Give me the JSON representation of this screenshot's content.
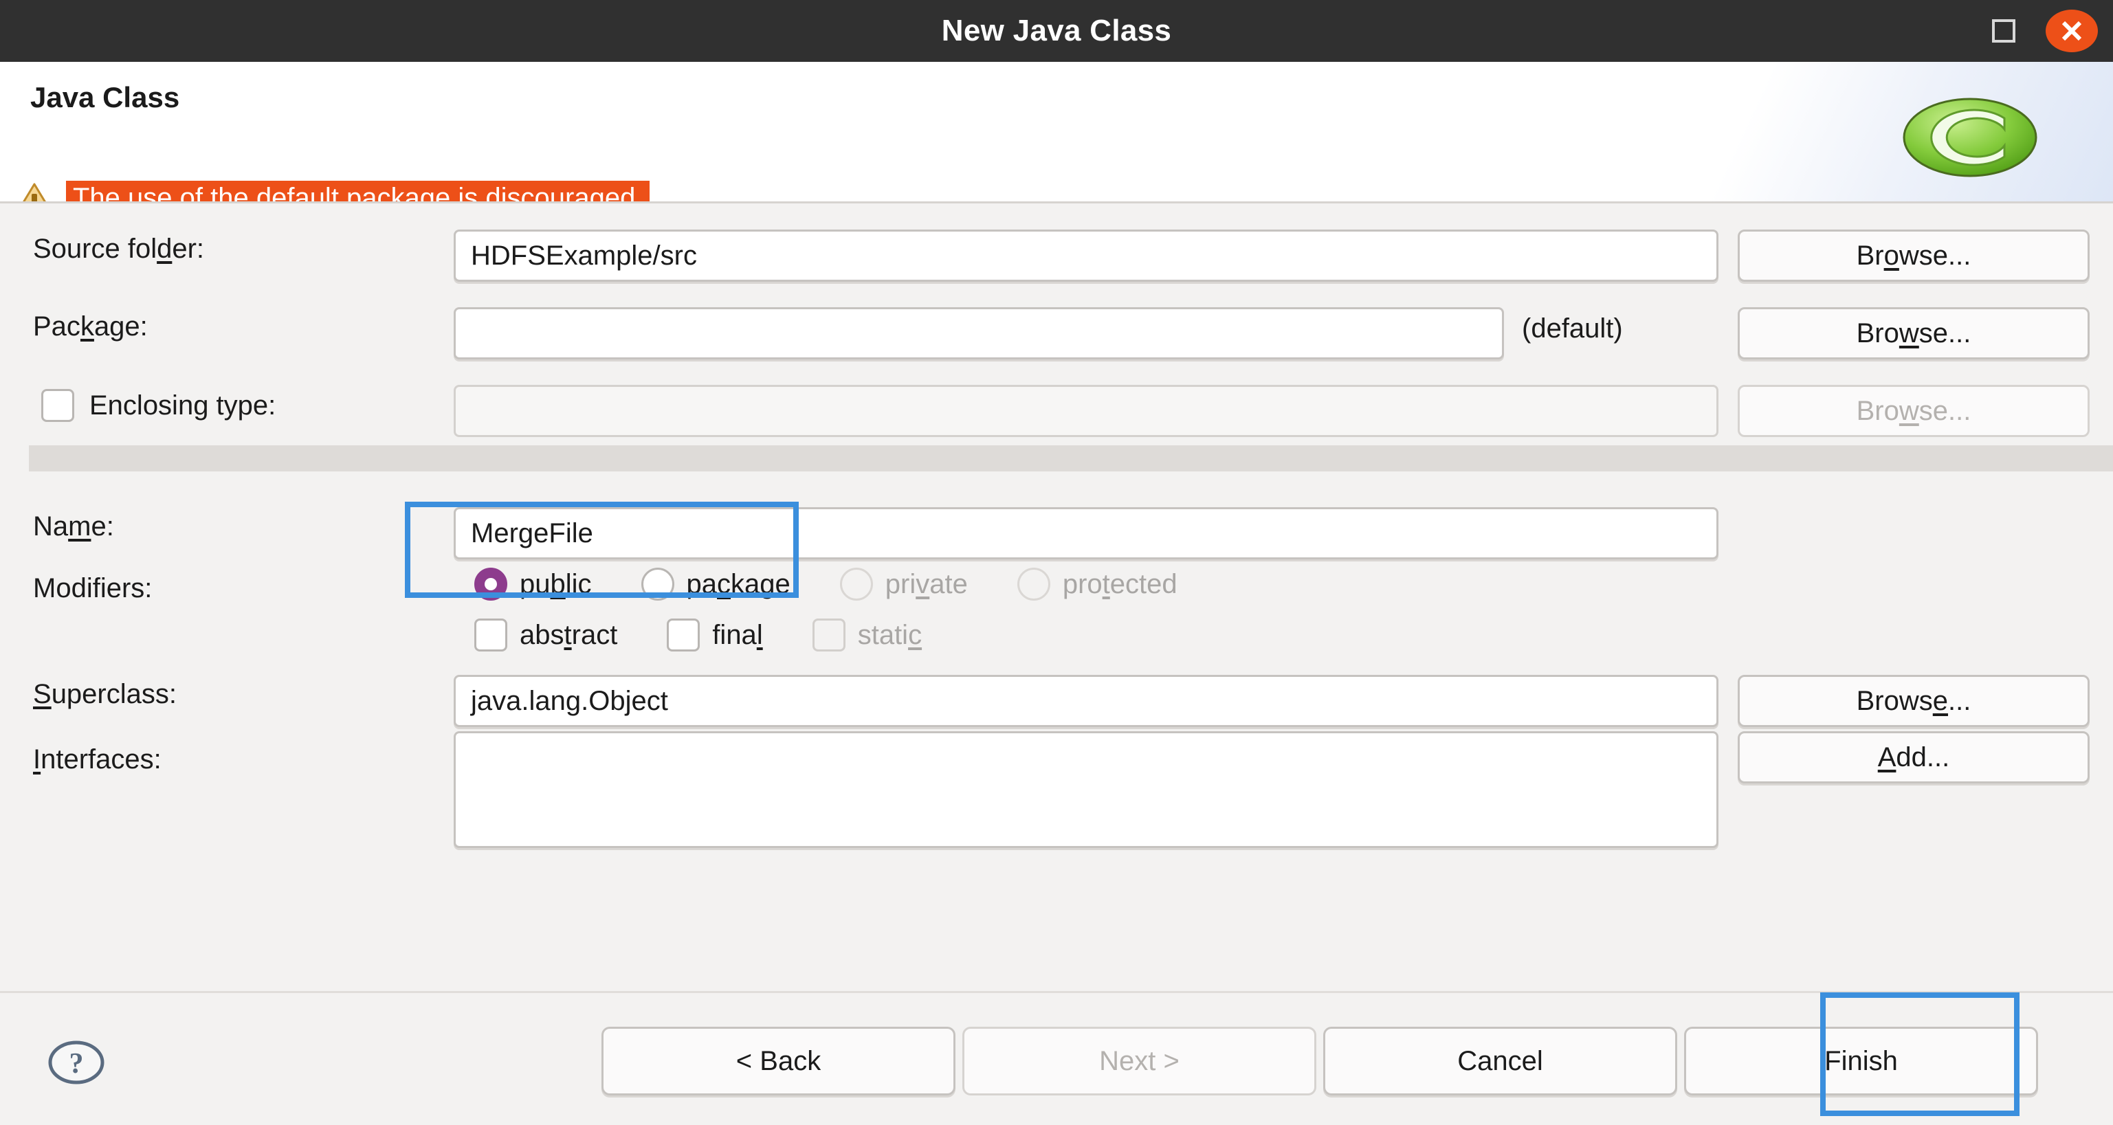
{
  "window": {
    "title": "New Java Class",
    "maximize_icon": "maximize-icon",
    "close_icon": "close-icon"
  },
  "header": {
    "title": "Java Class",
    "warning_icon": "warning-triangle-icon",
    "warning_text": "The use of the default package is discouraged.",
    "logo_icon": "eclipse-logo-icon",
    "warning_bg_color": "#ed5018"
  },
  "form": {
    "source_folder": {
      "label_pre": "Source fol",
      "label_mnemonic": "d",
      "label_post": "er:",
      "value": "HDFSExample/src",
      "browse_pre": "Br",
      "browse_mnemonic": "o",
      "browse_post": "wse..."
    },
    "package": {
      "label_pre": "Pac",
      "label_mnemonic": "k",
      "label_post": "age:",
      "value": "",
      "suffix": "(default)",
      "browse_pre": "Bro",
      "browse_mnemonic": "w",
      "browse_post": "se..."
    },
    "enclosing_type": {
      "label": "Enclosing type:",
      "checked": false,
      "value": "",
      "disabled": true,
      "browse_pre": "Bro",
      "browse_mnemonic": "w",
      "browse_post": "se..."
    },
    "name": {
      "label_pre": "Na",
      "label_mnemonic": "m",
      "label_post": "e:",
      "value": "MergeFile"
    },
    "modifiers": {
      "label": "Modifiers:",
      "radios": [
        {
          "pre": "pu",
          "mnemonic": "b",
          "post": "lic",
          "checked": true,
          "disabled": false
        },
        {
          "pre": "pa",
          "mnemonic": "c",
          "post": "kage",
          "checked": false,
          "disabled": false
        },
        {
          "pre": "pri",
          "mnemonic": "v",
          "post": "ate",
          "checked": false,
          "disabled": true
        },
        {
          "pre": "pro",
          "mnemonic": "t",
          "post": "ected",
          "checked": false,
          "disabled": true
        }
      ],
      "checkboxes": [
        {
          "pre": "abs",
          "mnemonic": "t",
          "post": "ract",
          "checked": false,
          "disabled": false
        },
        {
          "pre": "fina",
          "mnemonic": "l",
          "post": "",
          "checked": false,
          "disabled": false
        },
        {
          "pre": "stati",
          "mnemonic": "c",
          "post": "",
          "checked": false,
          "disabled": true
        }
      ]
    },
    "superclass": {
      "label_pre": "",
      "label_mnemonic": "S",
      "label_post": "uperclass:",
      "value": "java.lang.Object",
      "browse_pre": "Brows",
      "browse_mnemonic": "e",
      "browse_post": "..."
    },
    "interfaces": {
      "label_pre": "",
      "label_mnemonic": "I",
      "label_post": "nterfaces:",
      "value": "",
      "add_pre": "",
      "add_mnemonic": "A",
      "add_post": "dd..."
    }
  },
  "footer": {
    "help_icon": "help-question-icon",
    "buttons": [
      {
        "label": "< Back",
        "disabled": false
      },
      {
        "label": "Next >",
        "disabled": true
      },
      {
        "label": "Cancel",
        "disabled": false
      },
      {
        "label": "Finish",
        "disabled": false
      }
    ]
  },
  "highlights": {
    "accent_color": "#3b8fdd",
    "targets": [
      "name-input",
      "finish-button"
    ]
  }
}
